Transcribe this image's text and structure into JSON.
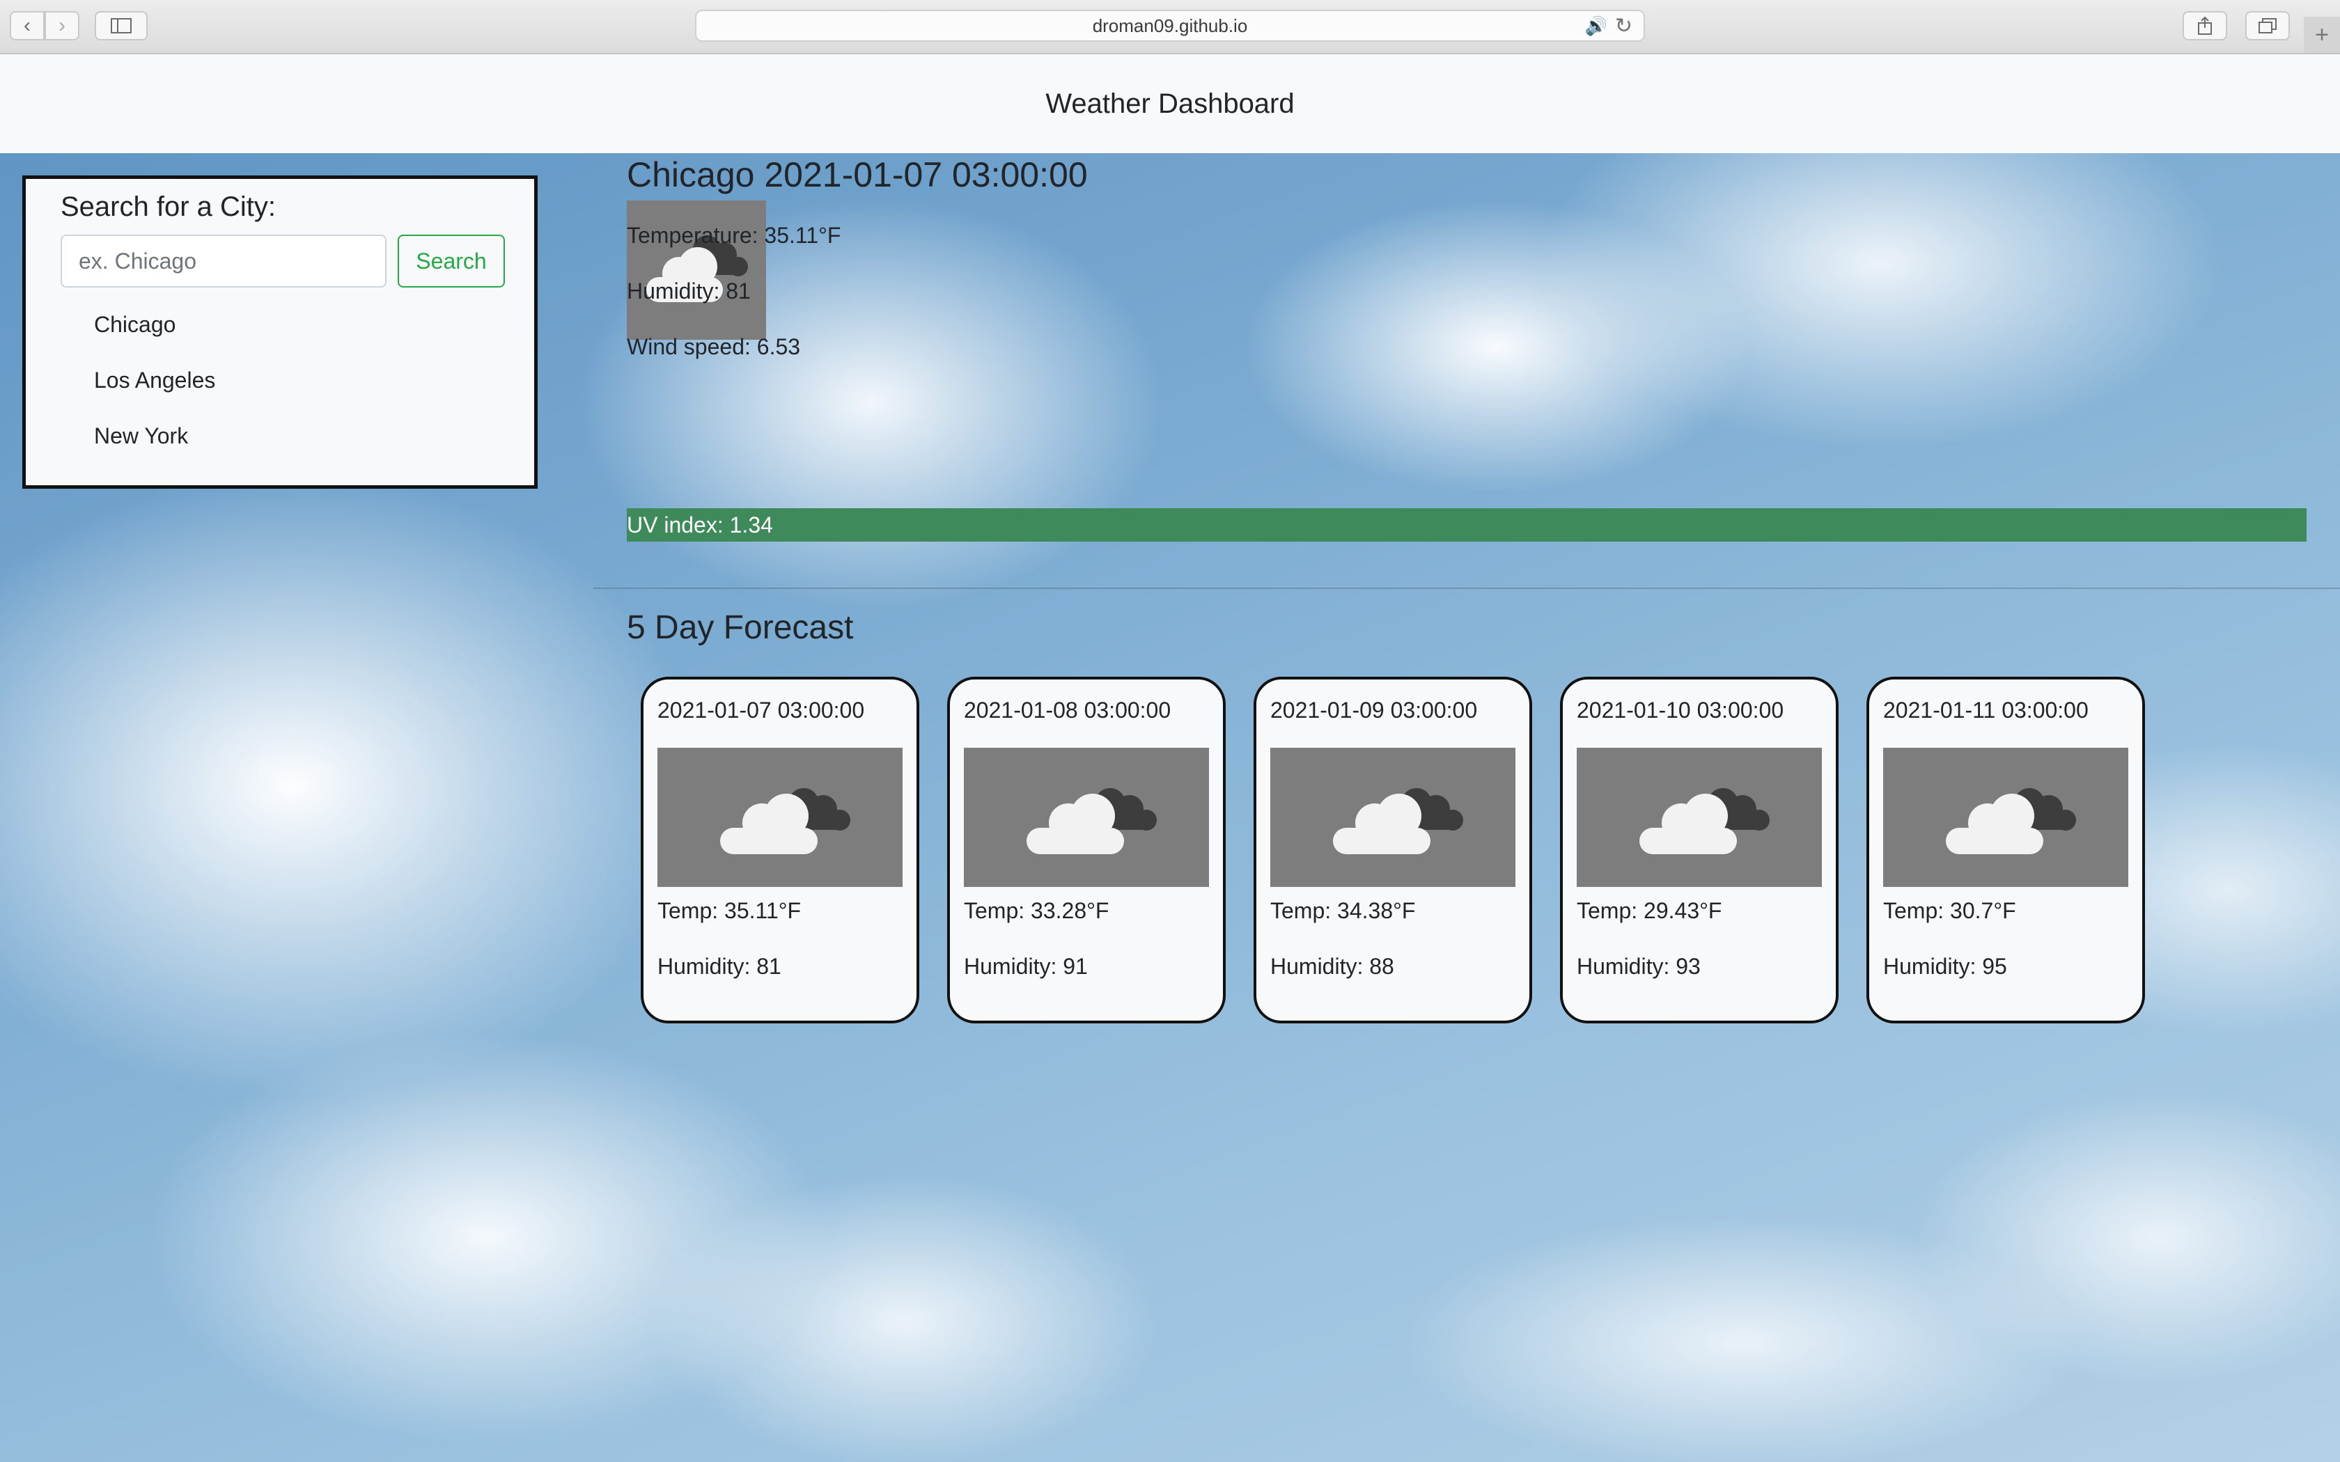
{
  "browser": {
    "url": "droman09.github.io"
  },
  "header": {
    "title": "Weather Dashboard"
  },
  "search": {
    "title": "Search for a City:",
    "placeholder": "ex. Chicago",
    "button_label": "Search",
    "history": [
      "Chicago",
      "Los Angeles",
      "New York"
    ]
  },
  "current": {
    "heading": "Chicago 2021-01-07 03:00:00",
    "icon": "broken-clouds-icon",
    "temperature": "Temperature: 35.11°F",
    "humidity": "Humidity: 81",
    "wind": "Wind speed: 6.53",
    "uv": "UV index: 1.34",
    "uv_color": "#3e8a5a"
  },
  "forecast": {
    "title": "5 Day Forecast",
    "days": [
      {
        "date": "2021-01-07 03:00:00",
        "icon": "broken-clouds-icon",
        "temp": "Temp: 35.11°F",
        "humidity": "Humidity: 81"
      },
      {
        "date": "2021-01-08 03:00:00",
        "icon": "broken-clouds-icon",
        "temp": "Temp: 33.28°F",
        "humidity": "Humidity: 91"
      },
      {
        "date": "2021-01-09 03:00:00",
        "icon": "broken-clouds-icon",
        "temp": "Temp: 34.38°F",
        "humidity": "Humidity: 88"
      },
      {
        "date": "2021-01-10 03:00:00",
        "icon": "broken-clouds-icon",
        "temp": "Temp: 29.43°F",
        "humidity": "Humidity: 93"
      },
      {
        "date": "2021-01-11 03:00:00",
        "icon": "broken-clouds-icon",
        "temp": "Temp: 30.7°F",
        "humidity": "Humidity: 95"
      }
    ]
  }
}
